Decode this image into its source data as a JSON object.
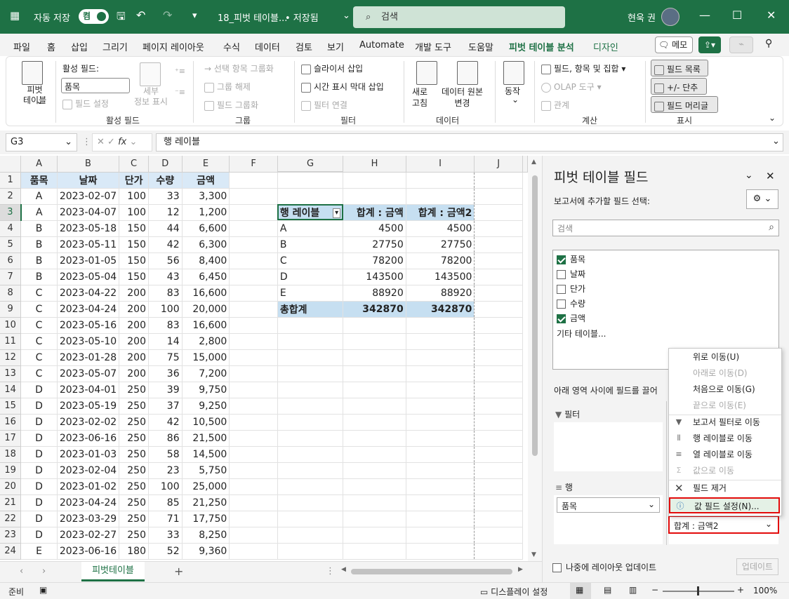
{
  "titlebar": {
    "autosave_label": "자동 저장",
    "autosave_state": "켬",
    "filename": "18_피벗 테이블...",
    "save_state": "• 저장됨",
    "search_placeholder": "검색",
    "user_name": "현욱 권"
  },
  "tabs": [
    "파일",
    "홈",
    "삽입",
    "그리기",
    "페이지 레이아웃",
    "수식",
    "데이터",
    "검토",
    "보기",
    "Automate",
    "개발 도구",
    "도움말",
    "피벗 테이블 분석",
    "디자인"
  ],
  "active_tab": "피벗 테이블 분석",
  "right_buttons": {
    "memo": "메모"
  },
  "ribbon": {
    "pivot_table": "피벗\n테이블",
    "active_field_label": "활성 필드:",
    "active_field_value": "품목",
    "field_settings": "필드 설정",
    "drill_down": "세부\n정보 표시",
    "group_active_field": "활성 필드",
    "group_selection": "선택 항목 그룹화",
    "ungroup": "그룹 해제",
    "group_field": "필드 그룹화",
    "group_group": "그룹",
    "insert_slicer": "슬라이서 삽입",
    "insert_timeline": "시간 표시 막대 삽입",
    "filter_connections": "필터 연결",
    "group_filter": "필터",
    "refresh": "새로\n고침",
    "change_source": "데이터 원본\n변경",
    "group_data": "데이터",
    "actions": "동작",
    "fields_items_sets": "필드, 항목 및 집합",
    "olap_tools": "OLAP 도구",
    "relationships": "관계",
    "group_calc": "계산",
    "field_list": "필드 목록",
    "buttons": "+/- 단추",
    "field_headers": "필드 머리글",
    "group_show": "표시"
  },
  "formula_bar": {
    "name_box": "G3",
    "formula": "행 레이블"
  },
  "columns": [
    "A",
    "B",
    "C",
    "D",
    "E",
    "F",
    "G",
    "H",
    "I",
    "J"
  ],
  "rows": [
    [
      "1",
      "품목",
      "날짜",
      "단가",
      "수량",
      "금액",
      "",
      "",
      "",
      ""
    ],
    [
      "2",
      "A",
      "2023-02-07",
      "100",
      "33",
      "3,300",
      "",
      "",
      "",
      ""
    ],
    [
      "3",
      "A",
      "2023-04-07",
      "100",
      "12",
      "1,200",
      "",
      "행 레이블",
      "합계 : 금액",
      "합계 : 금액2"
    ],
    [
      "4",
      "B",
      "2023-05-18",
      "150",
      "44",
      "6,600",
      "",
      "A",
      "4500",
      "4500"
    ],
    [
      "5",
      "B",
      "2023-05-11",
      "150",
      "42",
      "6,300",
      "",
      "B",
      "27750",
      "27750"
    ],
    [
      "6",
      "B",
      "2023-01-05",
      "150",
      "56",
      "8,400",
      "",
      "C",
      "78200",
      "78200"
    ],
    [
      "7",
      "B",
      "2023-05-04",
      "150",
      "43",
      "6,450",
      "",
      "D",
      "143500",
      "143500"
    ],
    [
      "8",
      "C",
      "2023-04-22",
      "200",
      "83",
      "16,600",
      "",
      "E",
      "88920",
      "88920"
    ],
    [
      "9",
      "C",
      "2023-04-24",
      "200",
      "100",
      "20,000",
      "",
      "총합계",
      "342870",
      "342870"
    ],
    [
      "10",
      "C",
      "2023-05-16",
      "200",
      "83",
      "16,600",
      "",
      "",
      "",
      ""
    ],
    [
      "11",
      "C",
      "2023-05-10",
      "200",
      "14",
      "2,800",
      "",
      "",
      "",
      ""
    ],
    [
      "12",
      "C",
      "2023-01-28",
      "200",
      "75",
      "15,000",
      "",
      "",
      "",
      ""
    ],
    [
      "13",
      "C",
      "2023-05-07",
      "200",
      "36",
      "7,200",
      "",
      "",
      "",
      ""
    ],
    [
      "14",
      "D",
      "2023-04-01",
      "250",
      "39",
      "9,750",
      "",
      "",
      "",
      ""
    ],
    [
      "15",
      "D",
      "2023-05-19",
      "250",
      "37",
      "9,250",
      "",
      "",
      "",
      ""
    ],
    [
      "16",
      "D",
      "2023-02-02",
      "250",
      "42",
      "10,500",
      "",
      "",
      "",
      ""
    ],
    [
      "17",
      "D",
      "2023-06-16",
      "250",
      "86",
      "21,500",
      "",
      "",
      "",
      ""
    ],
    [
      "18",
      "D",
      "2023-01-03",
      "250",
      "58",
      "14,500",
      "",
      "",
      "",
      ""
    ],
    [
      "19",
      "D",
      "2023-02-04",
      "250",
      "23",
      "5,750",
      "",
      "",
      "",
      ""
    ],
    [
      "20",
      "D",
      "2023-01-02",
      "250",
      "100",
      "25,000",
      "",
      "",
      "",
      ""
    ],
    [
      "21",
      "D",
      "2023-04-24",
      "250",
      "85",
      "21,250",
      "",
      "",
      "",
      ""
    ],
    [
      "22",
      "D",
      "2023-03-29",
      "250",
      "71",
      "17,750",
      "",
      "",
      "",
      ""
    ],
    [
      "23",
      "D",
      "2023-02-27",
      "250",
      "33",
      "8,250",
      "",
      "",
      "",
      ""
    ],
    [
      "24",
      "E",
      "2023-06-16",
      "180",
      "52",
      "9,360",
      "",
      "",
      "",
      ""
    ]
  ],
  "sheet_tab": "피벗테이블",
  "status": {
    "ready": "준비",
    "display_settings": "디스플레이 설정",
    "zoom": "100%"
  },
  "pane": {
    "title": "피벗 테이블 필드",
    "subtitle": "보고서에 추가할 필드 선택:",
    "search_placeholder": "검색",
    "fields": [
      {
        "label": "품목",
        "checked": true
      },
      {
        "label": "날짜",
        "checked": false
      },
      {
        "label": "단가",
        "checked": false
      },
      {
        "label": "수량",
        "checked": false
      },
      {
        "label": "금액",
        "checked": true
      }
    ],
    "more_tables": "기타 테이블...",
    "drag_hint": "아래 영역 사이에 필드를 끌어",
    "filters_label": "필터",
    "rows_label": "행",
    "row_item": "품목",
    "value_item": "합계 : 금액2",
    "defer_label": "나중에 레이아웃 업데이트",
    "update_button": "업데이트"
  },
  "context_menu": [
    {
      "label": "위로 이동(U)",
      "disabled": false,
      "icon": ""
    },
    {
      "label": "아래로 이동(D)",
      "disabled": true,
      "icon": ""
    },
    {
      "label": "처음으로 이동(G)",
      "disabled": false,
      "icon": ""
    },
    {
      "label": "끝으로 이동(E)",
      "disabled": true,
      "icon": ""
    },
    {
      "label": "보고서 필터로 이동",
      "disabled": false,
      "icon": "filter-icon"
    },
    {
      "label": "행 레이블로 이동",
      "disabled": false,
      "icon": "rows-icon"
    },
    {
      "label": "열 레이블로 이동",
      "disabled": false,
      "icon": "columns-icon"
    },
    {
      "label": "값으로 이동",
      "disabled": true,
      "icon": "sigma-icon"
    },
    {
      "label": "필드 제거",
      "disabled": false,
      "icon": "remove-icon"
    },
    {
      "label": "값 필드 설정(N)...",
      "disabled": false,
      "icon": "settings-icon",
      "highlighted": true
    }
  ],
  "colors": {
    "excel_green": "#1e7145",
    "pivot_header": "#c6dff1",
    "highlight_red": "#e30b0b"
  }
}
